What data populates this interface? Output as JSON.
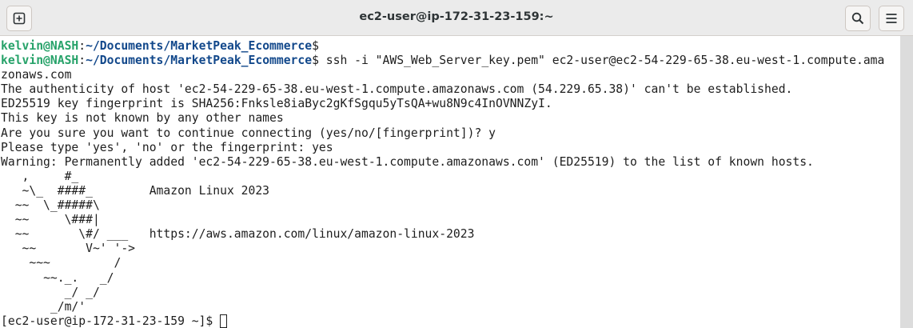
{
  "window": {
    "title": "ec2-user@ip-172-31-23-159:~"
  },
  "toolbar": {
    "new_tab_icon": "new-tab-icon",
    "search_icon": "search-icon",
    "menu_icon": "hamburger-menu-icon"
  },
  "colors": {
    "user_host": "#26a269",
    "path": "#12488b"
  },
  "terminal": {
    "prompt1": {
      "user": "kelvin@NASH",
      "sep": ":",
      "path": "~/Documents/MarketPeak_Ecommerce",
      "symbol": "$",
      "command": ""
    },
    "prompt2": {
      "user": "kelvin@NASH",
      "sep": ":",
      "path": "~/Documents/MarketPeak_Ecommerce",
      "symbol": "$",
      "command": " ssh -i \"AWS_Web_Server_key.pem\" ec2-user@ec2-54-229-65-38.eu-west-1.compute.amazonaws.com"
    },
    "output": [
      "The authenticity of host 'ec2-54-229-65-38.eu-west-1.compute.amazonaws.com (54.229.65.38)' can't be established.",
      "ED25519 key fingerprint is SHA256:Fnksle8iaByc2gKfSgqu5yTsQA+wu8N9c4InOVNNZyI.",
      "This key is not known by any other names",
      "Are you sure you want to continue connecting (yes/no/[fingerprint])? y",
      "Please type 'yes', 'no' or the fingerprint: yes",
      "Warning: Permanently added 'ec2-54-229-65-38.eu-west-1.compute.amazonaws.com' (ED25519) to the list of known hosts.",
      "   ,     #_",
      "   ~\\_  ####_        Amazon Linux 2023",
      "  ~~  \\_#####\\",
      "  ~~     \\###|",
      "  ~~       \\#/ ___   https://aws.amazon.com/linux/amazon-linux-2023",
      "   ~~       V~' '->",
      "    ~~~         /",
      "      ~~._.   _/",
      "         _/ _/",
      "       _/m/'"
    ],
    "remote_prompt": "[ec2-user@ip-172-31-23-159 ~]$ "
  }
}
